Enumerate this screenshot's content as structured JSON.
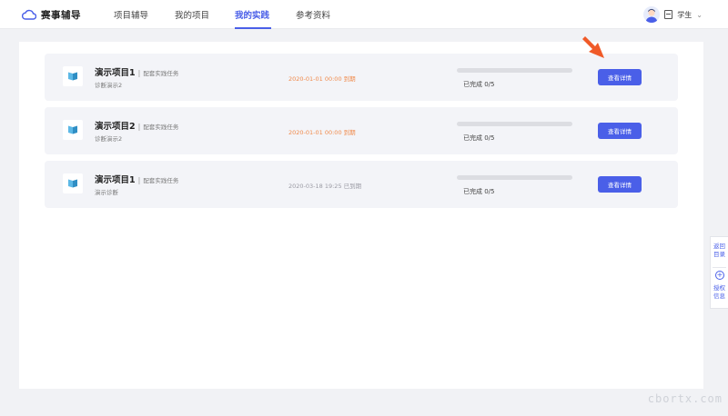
{
  "header": {
    "brand": "赛事辅导",
    "nav": [
      {
        "label": "项目辅导",
        "active": false
      },
      {
        "label": "我的项目",
        "active": false
      },
      {
        "label": "我的实践",
        "active": true
      },
      {
        "label": "参考资料",
        "active": false
      }
    ],
    "user": {
      "role": "学生"
    }
  },
  "cards": [
    {
      "title": "演示项目1",
      "tag": "配套实践任务",
      "subtitle": "诊断演示2",
      "deadline": "2020-01-01 00:00 到期",
      "deadline_status": "warn",
      "progress_text": "已完成 0/5",
      "progress_fraction": 0,
      "button": "查看详情"
    },
    {
      "title": "演示项目2",
      "tag": "配套实践任务",
      "subtitle": "诊断演示2",
      "deadline": "2020-01-01 00:00 到期",
      "deadline_status": "warn",
      "progress_text": "已完成 0/5",
      "progress_fraction": 0,
      "button": "查看详情"
    },
    {
      "title": "演示项目1",
      "tag": "配套实践任务",
      "subtitle": "演示诊断",
      "deadline": "2020-03-18 19:25 已到期",
      "deadline_status": "done",
      "progress_text": "已完成 0/5",
      "progress_fraction": 0,
      "button": "查看详情"
    }
  ],
  "float_widget": {
    "top_label": "返回目录",
    "bottom_label": "授权信息"
  },
  "watermark": "cbortx.com",
  "colors": {
    "accent": "#4a5fe8",
    "deadline_warn": "#f08a4b",
    "deadline_done": "#9a9aa3",
    "arrow": "#f05a28"
  },
  "icons": {
    "brand": "cloud-icon",
    "card_logo": "book-icon",
    "annotation": "arrow-pointer-icon"
  }
}
